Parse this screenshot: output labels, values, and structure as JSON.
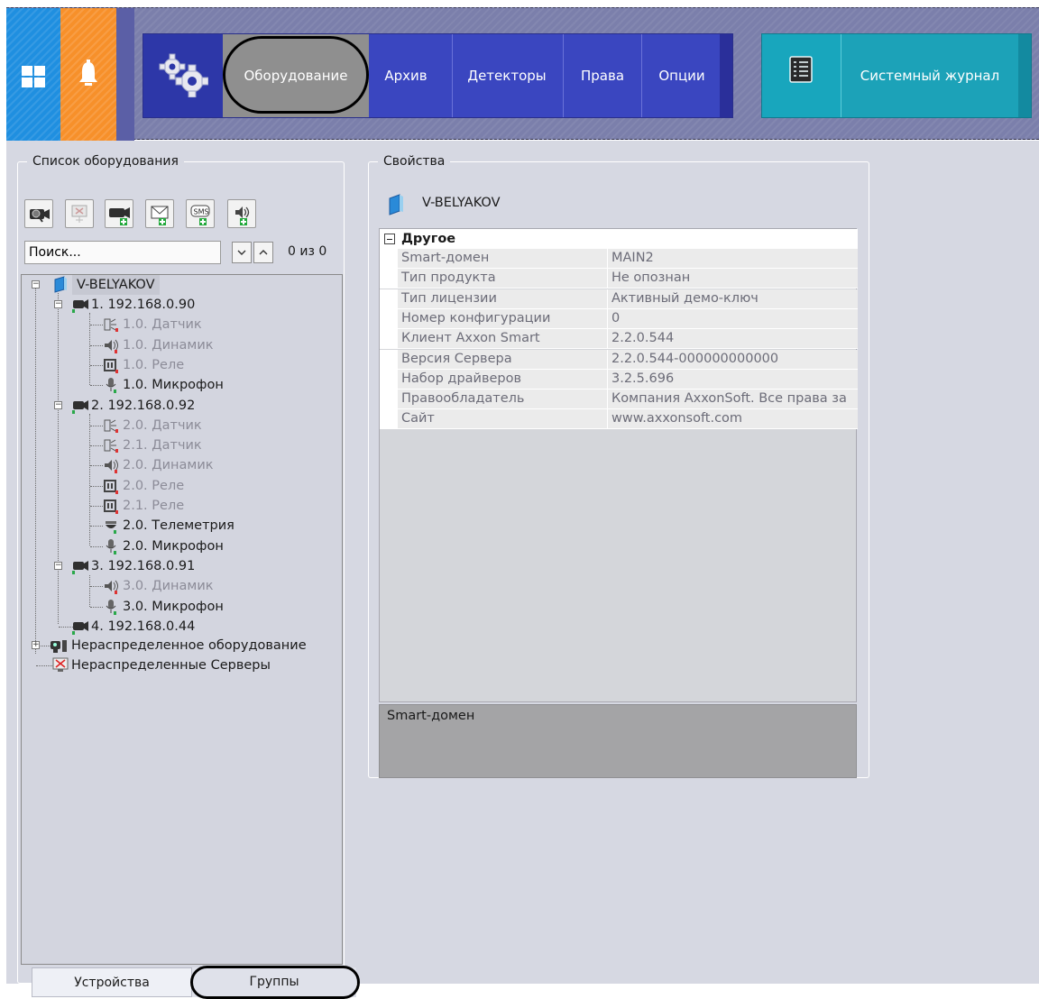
{
  "topbar": {
    "tabs": [
      {
        "label": "Оборудование",
        "active": true
      },
      {
        "label": "Архив",
        "active": false
      },
      {
        "label": "Детекторы",
        "active": false
      },
      {
        "label": "Права",
        "active": false
      },
      {
        "label": "Опции",
        "active": false
      }
    ],
    "journal_label": "Системный журнал",
    "colors": {
      "home_tile": "#1f8fe0",
      "alerts_tile": "#f7902a",
      "nav_strip": "#3a46c0",
      "journal_strip": "#1ca2b8"
    }
  },
  "equipment": {
    "legend": "Список оборудования",
    "search_value": "Поиск...",
    "count_label": "0 из 0",
    "toolbar_icons": [
      "camera-search-icon",
      "remove-server-icon",
      "add-camera-icon",
      "add-email-icon",
      "add-sms-icon",
      "add-speaker-icon"
    ],
    "tree": {
      "root": "V-BELYAKOV",
      "devices": [
        {
          "label": "1. 192.168.0.90",
          "children": [
            {
              "label": "1.0. Датчик",
              "icon": "sensor-icon",
              "dim": true
            },
            {
              "label": "1.0. Динамик",
              "icon": "speaker-icon",
              "dim": true
            },
            {
              "label": "1.0. Реле",
              "icon": "relay-icon",
              "dim": true
            },
            {
              "label": "1.0. Микрофон",
              "icon": "microphone-icon",
              "dim": false
            }
          ]
        },
        {
          "label": "2. 192.168.0.92",
          "children": [
            {
              "label": "2.0. Датчик",
              "icon": "sensor-icon",
              "dim": true
            },
            {
              "label": "2.1. Датчик",
              "icon": "sensor-icon",
              "dim": true
            },
            {
              "label": "2.0. Динамик",
              "icon": "speaker-icon",
              "dim": true
            },
            {
              "label": "2.0. Реле",
              "icon": "relay-icon",
              "dim": true
            },
            {
              "label": "2.1. Реле",
              "icon": "relay-icon",
              "dim": true
            },
            {
              "label": "2.0. Телеметрия",
              "icon": "ptz-dome-icon",
              "dim": false
            },
            {
              "label": "2.0. Микрофон",
              "icon": "microphone-icon",
              "dim": false
            }
          ]
        },
        {
          "label": "3. 192.168.0.91",
          "children": [
            {
              "label": "3.0. Динамик",
              "icon": "speaker-icon",
              "dim": true
            },
            {
              "label": "3.0. Микрофон",
              "icon": "microphone-icon",
              "dim": false
            }
          ]
        },
        {
          "label": "4. 192.168.0.44",
          "children": []
        }
      ],
      "unassigned_equipment": "Нераспределенное оборудование",
      "unassigned_servers": "Нераспределенные Серверы"
    },
    "tabs": {
      "devices": "Устройства",
      "groups": "Группы"
    }
  },
  "properties": {
    "legend": "Свойства",
    "server_name": "V-BELYAKOV",
    "category": "Другое",
    "rows": [
      {
        "name": "Smart-домен",
        "value": "MAIN2"
      },
      {
        "name": "Тип продукта",
        "value": "Не опознан"
      },
      {
        "name": "Тип лицензии",
        "value": "Активный демо-ключ"
      },
      {
        "name": "Номер конфигурации",
        "value": "0"
      },
      {
        "name": "Клиент Axxon Smart",
        "value": "2.2.0.544"
      },
      {
        "name": "Версия Сервера",
        "value": "2.2.0.544-000000000000"
      },
      {
        "name": "Набор драйверов",
        "value": "3.2.5.696"
      },
      {
        "name": "Правообладатель",
        "value": "Компания AxxonSoft. Все права за"
      },
      {
        "name": "Сайт",
        "value": "www.axxonsoft.com"
      }
    ],
    "description": "Smart-домен"
  }
}
